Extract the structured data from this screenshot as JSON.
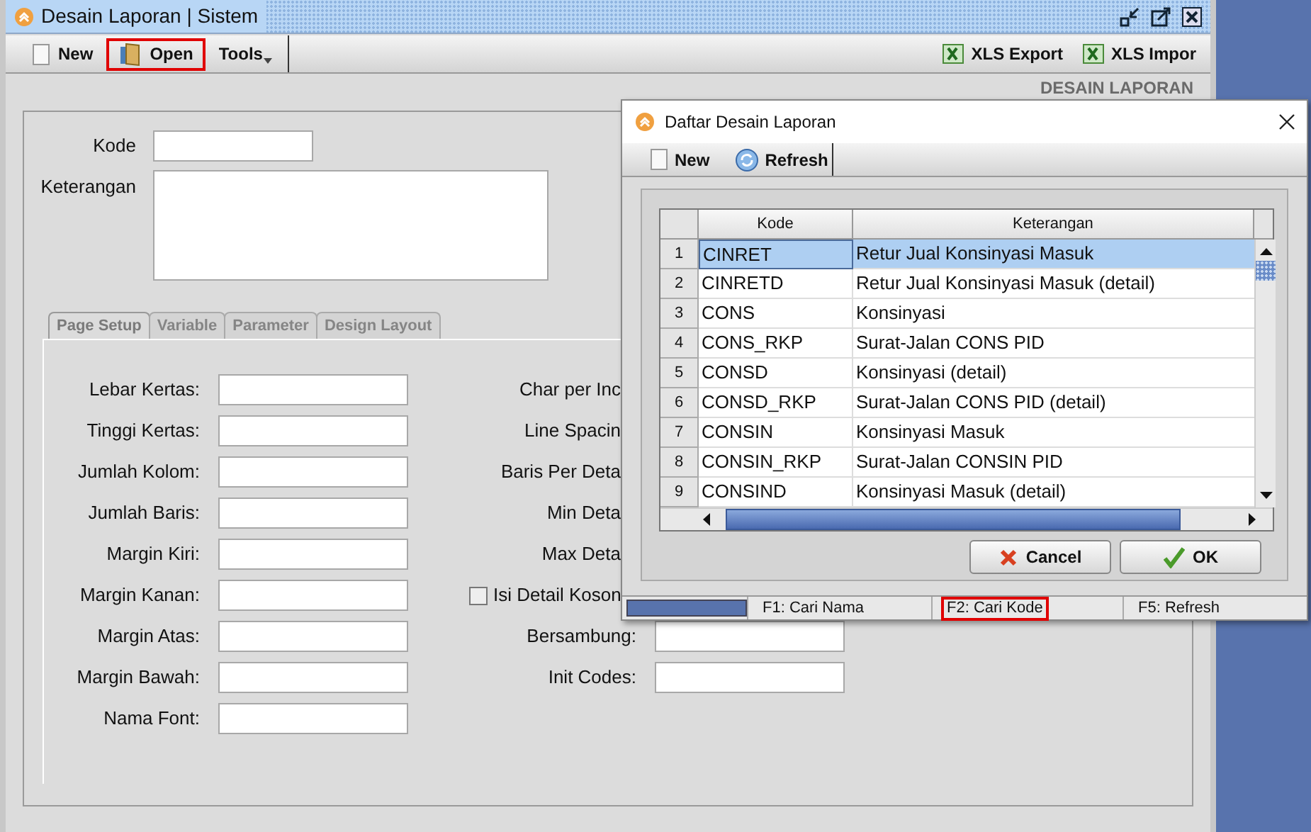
{
  "main_window": {
    "title": "Desain Laporan | Sistem",
    "toolbar": [
      {
        "kind": "new",
        "label": "New",
        "highlighted": false
      },
      {
        "kind": "open",
        "label": "Open",
        "highlighted": true
      },
      {
        "kind": "menu",
        "label": "Tools",
        "highlighted": false
      }
    ],
    "toolbar_right": [
      {
        "label": "XLS Export"
      },
      {
        "label": "XLS Impor"
      }
    ],
    "header": "DESAIN LAPORAN",
    "kode_label": "Kode",
    "keterangan_label": "Keterangan",
    "tabs": [
      {
        "label": "Page Setup",
        "selected": true
      },
      {
        "label": "Variable",
        "selected": false
      },
      {
        "label": "Parameter",
        "selected": false
      },
      {
        "label": "Design Layout",
        "selected": false
      }
    ],
    "left_fields": [
      "Lebar Kertas:",
      "Tinggi Kertas:",
      "Jumlah Kolom:",
      "Jumlah Baris:",
      "Margin Kiri:",
      "Margin Kanan:",
      "Margin Atas:",
      "Margin Bawah:",
      "Nama Font:"
    ],
    "right_fields": [
      {
        "kind": "hidden",
        "label": "Char per Inc"
      },
      {
        "kind": "hidden",
        "label": "Line Spacin"
      },
      {
        "kind": "hidden",
        "label": "Baris Per Deta"
      },
      {
        "kind": "hidden",
        "label": "Min Deta"
      },
      {
        "kind": "hidden",
        "label": "Max Deta"
      },
      {
        "kind": "checkbox",
        "label": "Isi Detail Koson",
        "checked": false
      },
      {
        "kind": "input",
        "label": "Bersambung:"
      },
      {
        "kind": "input",
        "label": "Init Codes:"
      }
    ]
  },
  "dialog": {
    "title": "Daftar Desain Laporan",
    "toolbar": [
      {
        "kind": "new",
        "label": "New"
      },
      {
        "kind": "refresh",
        "label": "Refresh"
      }
    ],
    "table": {
      "columns": [
        "Kode",
        "Keterangan"
      ],
      "rows": [
        {
          "number": "1",
          "kode": "CINRET",
          "keterangan": "Retur Jual Konsinyasi Masuk",
          "selected": true
        },
        {
          "number": "2",
          "kode": "CINRETD",
          "keterangan": "Retur Jual Konsinyasi Masuk (detail)",
          "selected": false
        },
        {
          "number": "3",
          "kode": "CONS",
          "keterangan": "Konsinyasi",
          "selected": false
        },
        {
          "number": "4",
          "kode": "CONS_RKP",
          "keterangan": "Surat-Jalan CONS PID",
          "selected": false
        },
        {
          "number": "5",
          "kode": "CONSD",
          "keterangan": "Konsinyasi (detail)",
          "selected": false
        },
        {
          "number": "6",
          "kode": "CONSD_RKP",
          "keterangan": "Surat-Jalan CONS PID (detail)",
          "selected": false
        },
        {
          "number": "7",
          "kode": "CONSIN",
          "keterangan": "Konsinyasi Masuk",
          "selected": false
        },
        {
          "number": "8",
          "kode": "CONSIN_RKP",
          "keterangan": "Surat-Jalan CONSIN PID",
          "selected": false
        },
        {
          "number": "9",
          "kode": "CONSIND",
          "keterangan": "Konsinyasi Masuk (detail)",
          "selected": false
        }
      ]
    },
    "buttons": [
      {
        "kind": "cancel",
        "label": "Cancel"
      },
      {
        "kind": "ok",
        "label": "OK"
      }
    ],
    "status_bar": [
      {
        "label": "F1: Cari Nama",
        "highlighted": false
      },
      {
        "label": "F2: Cari Kode",
        "highlighted": true
      },
      {
        "label": "F5: Refresh",
        "highlighted": false
      }
    ]
  }
}
